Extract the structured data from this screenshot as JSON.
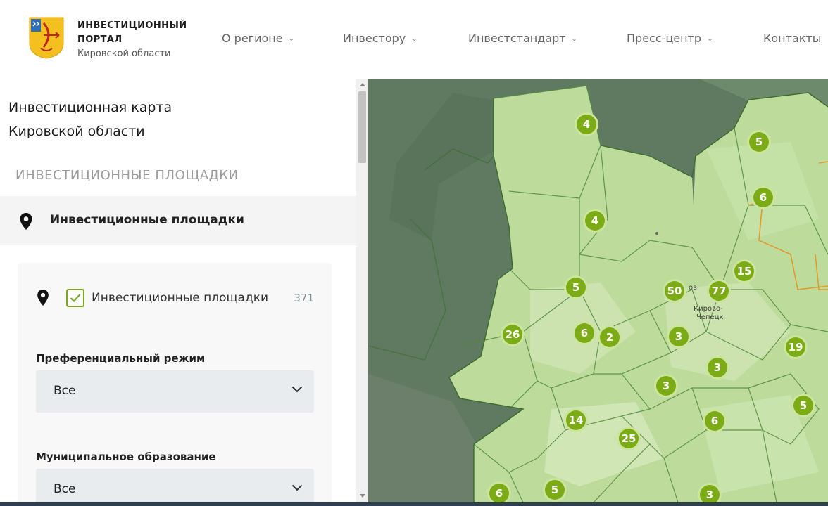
{
  "brand": {
    "line1": "ИНВЕСТИЦИОННЫЙ",
    "line2": "ПОРТАЛ",
    "line3": "Кировской области"
  },
  "nav": {
    "items": [
      {
        "label": "О регионе",
        "has_dropdown": true
      },
      {
        "label": "Инвестору",
        "has_dropdown": true
      },
      {
        "label": "Инвестстандарт",
        "has_dropdown": true
      },
      {
        "label": "Пресс-центр",
        "has_dropdown": true
      },
      {
        "label": "Контакты",
        "has_dropdown": false
      }
    ]
  },
  "sidebar": {
    "title_line1": "Инвестиционная карта",
    "title_line2": "Кировской области",
    "section_caption": "ИНВЕСТИЦИОННЫЕ ПЛОЩАДКИ",
    "layer_label": "Инвестиционные площадки",
    "filter": {
      "checkbox_label": "Инвестиционные площадки",
      "checked": true,
      "count": "371",
      "preferential": {
        "label": "Преференциальный режим",
        "value": "Все"
      },
      "municipality": {
        "label": "Муниципальное образование",
        "value": "Все"
      }
    }
  },
  "map": {
    "clusters": [
      "4",
      "5",
      "6",
      "4",
      "15",
      "5",
      "50",
      "77",
      "26",
      "6",
      "2",
      "3",
      "19",
      "3",
      "3",
      "5",
      "14",
      "6",
      "25",
      "6",
      "5",
      "3"
    ],
    "cities": {
      "city1": "Кирово-",
      "city2": "Чепецк",
      "city3": "ов"
    }
  },
  "colors": {
    "accent": "#7bac16",
    "checkbox_border": "#7aa62a",
    "map_region_fill": "#bddc9c",
    "map_outside": "#5f7a60",
    "border_orange": "#e39a2c"
  }
}
